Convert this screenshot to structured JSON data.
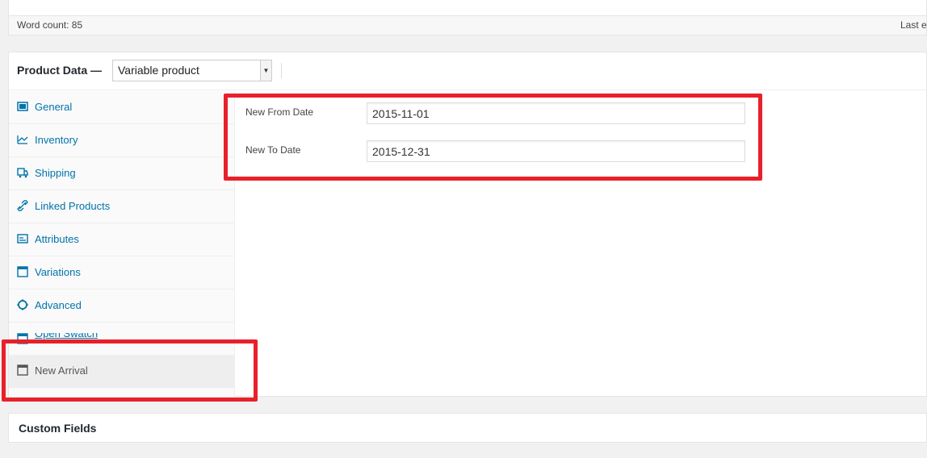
{
  "status": {
    "word_count": "Word count: 85",
    "last_edited": "Last edi"
  },
  "product_data": {
    "title": "Product Data —",
    "type_selected": "Variable product"
  },
  "tabs": [
    {
      "label": "General",
      "icon": "general-icon"
    },
    {
      "label": "Inventory",
      "icon": "inventory-icon"
    },
    {
      "label": "Shipping",
      "icon": "truck-icon"
    },
    {
      "label": "Linked Products",
      "icon": "link-icon"
    },
    {
      "label": "Attributes",
      "icon": "list-icon"
    },
    {
      "label": "Variations",
      "icon": "window-icon"
    },
    {
      "label": "Advanced",
      "icon": "gear-icon"
    },
    {
      "label": "Open Swatch",
      "icon": "window-icon"
    },
    {
      "label": "New Arrival",
      "icon": "window-icon",
      "active": true
    }
  ],
  "fields": {
    "new_from_date": {
      "label": "New From Date",
      "value": "2015-11-01"
    },
    "new_to_date": {
      "label": "New To Date",
      "value": "2015-12-31"
    }
  },
  "custom_fields": {
    "title": "Custom Fields"
  },
  "colors": {
    "highlight": "#e8202a",
    "link": "#0073aa"
  }
}
